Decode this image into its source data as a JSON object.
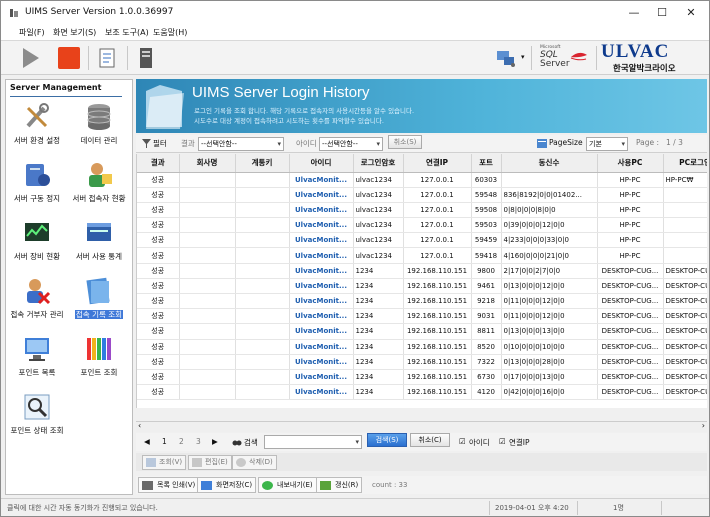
{
  "window": {
    "title": "UIMS Server Version 1.0.0.36997",
    "minimize": "—",
    "maximize": "☐",
    "close": "✕"
  },
  "menu": [
    "파일(F)",
    "화면 보기(S)",
    "보조 도구(A)",
    "도움말(H)"
  ],
  "left_panel": {
    "header": "Server Management",
    "items": [
      {
        "label": "서버 환경 설정",
        "icon": "tools-icon"
      },
      {
        "label": "데이터 관리",
        "icon": "database-icon"
      },
      {
        "label": "서버 구동 정지",
        "icon": "server-start-stop-icon"
      },
      {
        "label": "서버 접속자 현황",
        "icon": "connected-users-icon"
      },
      {
        "label": "서버 장비 현황",
        "icon": "equipment-icon"
      },
      {
        "label": "서버 사용 통계",
        "icon": "usage-stats-icon"
      },
      {
        "label": "접속 거부자 관리",
        "icon": "denied-user-icon"
      },
      {
        "label": "접속 기록 조회",
        "icon": "login-history-icon",
        "selected": true
      },
      {
        "label": "포인트 목록",
        "icon": "point-list-icon"
      },
      {
        "label": "포인트 조회",
        "icon": "point-query-icon"
      },
      {
        "label": "포인트 상태 조회",
        "icon": "point-status-icon"
      }
    ]
  },
  "logo": {
    "sql_top": "Microsoft",
    "sql_mid": "SQL",
    "sql_bottom": "Server",
    "brand": "ULVAC",
    "brand_sub": "한국알박크라이오"
  },
  "banner": {
    "title": "UIMS Server Login History",
    "line1": "로그인 기록을 조회 합니다. 해당 기록으로 접속자의 사용시간등을 알수 있습니다.",
    "line2": "시도수로 대상 계정이 접속하려고 시도하는 횟수를 파악할수 있습니다."
  },
  "filter": {
    "filter_label": "필터",
    "result_label": "결과",
    "result_value": "--선택안함--",
    "id_label": "아이디",
    "id_value": "--선택안함--",
    "cancel": "취소(S)",
    "pagesize_label": "PageSize",
    "pagesize_value": "기본",
    "page_label": "Page :",
    "page_value": "1 / 3"
  },
  "table": {
    "columns": [
      "결과",
      "회사명",
      "계통키",
      "아이디",
      "로그인암호",
      "연결IP",
      "포트",
      "동신수",
      "사용PC",
      "PC로그인"
    ],
    "rows": [
      [
        "성공",
        "",
        "",
        "UlvacMonit...",
        "ulvac1234",
        "127.0.0.1",
        "60303",
        "",
        "HP-PC",
        "HP-PC₩"
      ],
      [
        "성공",
        "",
        "",
        "UlvacMonit...",
        "ulvac1234",
        "127.0.0.1",
        "59548",
        "836|8192|0|0|01402...",
        "HP-PC",
        ""
      ],
      [
        "성공",
        "",
        "",
        "UlvacMonit...",
        "ulvac1234",
        "127.0.0.1",
        "59508",
        "0|8|0|0|0|8|0|0",
        "HP-PC",
        ""
      ],
      [
        "성공",
        "",
        "",
        "UlvacMonit...",
        "ulvac1234",
        "127.0.0.1",
        "59503",
        "0|39|0|0|0|12|0|0",
        "HP-PC",
        ""
      ],
      [
        "성공",
        "",
        "",
        "UlvacMonit...",
        "ulvac1234",
        "127.0.0.1",
        "59459",
        "4|233|0|0|0|33|0|0",
        "HP-PC",
        ""
      ],
      [
        "성공",
        "",
        "",
        "UlvacMonit...",
        "ulvac1234",
        "127.0.0.1",
        "59418",
        "4|160|0|0|0|21|0|0",
        "HP-PC",
        ""
      ],
      [
        "성공",
        "",
        "",
        "UlvacMonit...",
        "1234",
        "192.168.110.151",
        "9800",
        "2|17|0|0|2|7|0|0",
        "DESKTOP-CUG...",
        "DESKTOP-CU("
      ],
      [
        "성공",
        "",
        "",
        "UlvacMonit...",
        "1234",
        "192.168.110.151",
        "9461",
        "0|13|0|0|0|12|0|0",
        "DESKTOP-CUG...",
        "DESKTOP-CU("
      ],
      [
        "성공",
        "",
        "",
        "UlvacMonit...",
        "1234",
        "192.168.110.151",
        "9218",
        "0|11|0|0|0|12|0|0",
        "DESKTOP-CUG...",
        "DESKTOP-CU("
      ],
      [
        "성공",
        "",
        "",
        "UlvacMonit...",
        "1234",
        "192.168.110.151",
        "9031",
        "0|11|0|0|0|12|0|0",
        "DESKTOP-CUG...",
        "DESKTOP-CU("
      ],
      [
        "성공",
        "",
        "",
        "UlvacMonit...",
        "1234",
        "192.168.110.151",
        "8811",
        "0|13|0|0|0|13|0|0",
        "DESKTOP-CUG...",
        "DESKTOP-CU("
      ],
      [
        "성공",
        "",
        "",
        "UlvacMonit...",
        "1234",
        "192.168.110.151",
        "8520",
        "0|10|0|0|0|10|0|0",
        "DESKTOP-CUG...",
        "DESKTOP-CU("
      ],
      [
        "성공",
        "",
        "",
        "UlvacMonit...",
        "1234",
        "192.168.110.151",
        "7322",
        "0|13|0|0|0|28|0|0",
        "DESKTOP-CUG...",
        "DESKTOP-CU("
      ],
      [
        "성공",
        "",
        "",
        "UlvacMonit...",
        "1234",
        "192.168.110.151",
        "6730",
        "0|17|0|0|0|13|0|0",
        "DESKTOP-CUG...",
        "DESKTOP-CU("
      ],
      [
        "성공",
        "",
        "",
        "UlvacMonit...",
        "1234",
        "192.168.110.151",
        "4120",
        "0|42|0|0|0|16|0|0",
        "DESKTOP-CUG...",
        "DESKTOP-CU("
      ]
    ]
  },
  "pager": {
    "pages": [
      "1",
      "2",
      "3"
    ],
    "search_label": "검색",
    "search_btn": "검색(S)",
    "cancel_btn": "취소(C)",
    "chk_id": "아이디",
    "chk_ip": "연결IP"
  },
  "actions": {
    "query": "조회(V)",
    "edit": "편집(E)",
    "delete": "삭제(D)"
  },
  "bottom": {
    "print": "목록 인쇄(V)",
    "save": "화면저장(C)",
    "export": "내보내기(E)",
    "refresh": "갱신(R)",
    "count": "count : 33"
  },
  "status": {
    "message": "클릭에 대한 시간 자동 동기화가 진행되고 있습니다.",
    "datetime": "2019-04-01 오후 4:20",
    "users": "1명"
  },
  "colors": {
    "banner": "#3a9fcf",
    "selection": "#3f78d8",
    "link": "#1f5fb0"
  }
}
